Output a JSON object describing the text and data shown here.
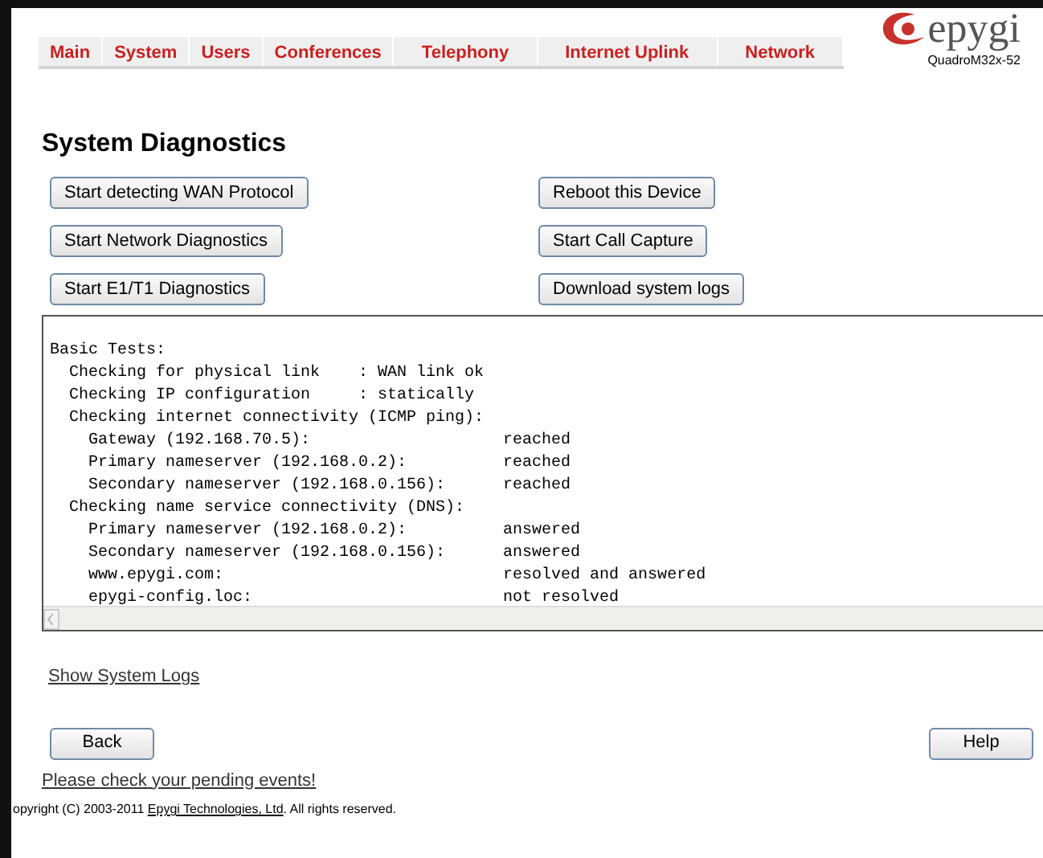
{
  "menu": [
    "Main",
    "System",
    "Users",
    "Conferences",
    "Telephony",
    "Internet Uplink",
    "Network"
  ],
  "logo": {
    "brand": "epygi",
    "model": "QuadroM32x-52"
  },
  "title": "System Diagnostics",
  "buttons_left": [
    "Start detecting WAN Protocol",
    "Start Network Diagnostics",
    "Start E1/T1 Diagnostics"
  ],
  "buttons_right": [
    "Reboot this Device",
    "Start Call Capture",
    "Download system logs"
  ],
  "output_lines": [
    "Basic Tests:",
    "  Checking for physical link    : WAN link ok",
    "  Checking IP configuration     : statically",
    "  Checking internet connectivity (ICMP ping):",
    "    Gateway (192.168.70.5):                    reached",
    "    Primary nameserver (192.168.0.2):          reached",
    "    Secondary nameserver (192.168.0.156):      reached",
    "  Checking name service connectivity (DNS):",
    "    Primary nameserver (192.168.0.2):          answered",
    "    Secondary nameserver (192.168.0.156):      answered",
    "    www.epygi.com:                             resolved and answered",
    "    epygi-config.loc:                          not resolved"
  ],
  "show_logs_link": "Show System Logs",
  "back_button": "Back",
  "help_button": "Help",
  "pending_link": "Please check your pending events!",
  "copyright": {
    "before": "opyright (C) 2003-2011 ",
    "link": "Epygi Technologies, Ltd",
    "after": ". All rights reserved."
  }
}
